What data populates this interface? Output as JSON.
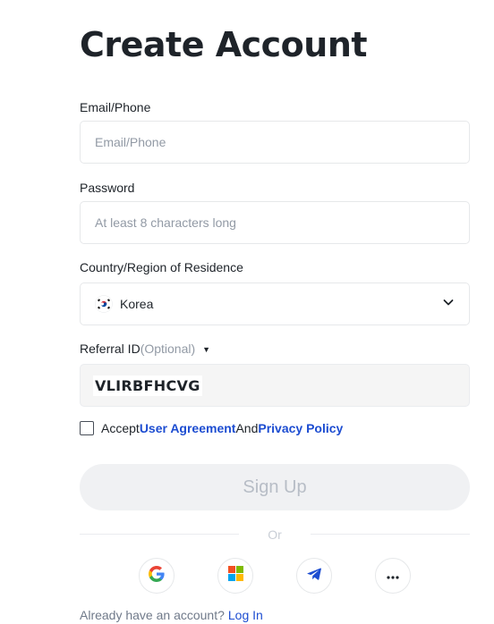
{
  "page": {
    "title": "Create Account"
  },
  "email": {
    "label": "Email/Phone",
    "placeholder": "Email/Phone",
    "value": ""
  },
  "password": {
    "label": "Password",
    "placeholder": "At least 8 characters long",
    "value": ""
  },
  "country": {
    "label": "Country/Region of Residence",
    "selected": "Korea",
    "flag_icon": "korea-flag-icon"
  },
  "referral": {
    "label": "Referral ID",
    "optional_label": "(Optional)",
    "toggle_icon": "caret-down-icon",
    "value": "VLIRBFHCVG"
  },
  "agreement": {
    "checked": false,
    "prefix": "Accept",
    "user_agreement": "User Agreement",
    "conjunction": "And",
    "privacy_policy": "Privacy Policy"
  },
  "signup_button": {
    "label": "Sign Up",
    "enabled": false
  },
  "divider": {
    "label": "Or"
  },
  "social_logins": [
    {
      "name": "google",
      "icon": "google-icon"
    },
    {
      "name": "microsoft",
      "icon": "microsoft-icon"
    },
    {
      "name": "telegram",
      "icon": "telegram-icon"
    },
    {
      "name": "more",
      "icon": "more-icon"
    }
  ],
  "footer": {
    "text": "Already have an account?",
    "login_link": "Log In"
  },
  "colors": {
    "primary_text": "#1e2329",
    "secondary_text": "#929aa5",
    "link": "#1d4dd1",
    "border": "#e6e8ea",
    "disabled_button_bg": "#f0f1f3",
    "disabled_button_text": "#b7bdc6"
  }
}
